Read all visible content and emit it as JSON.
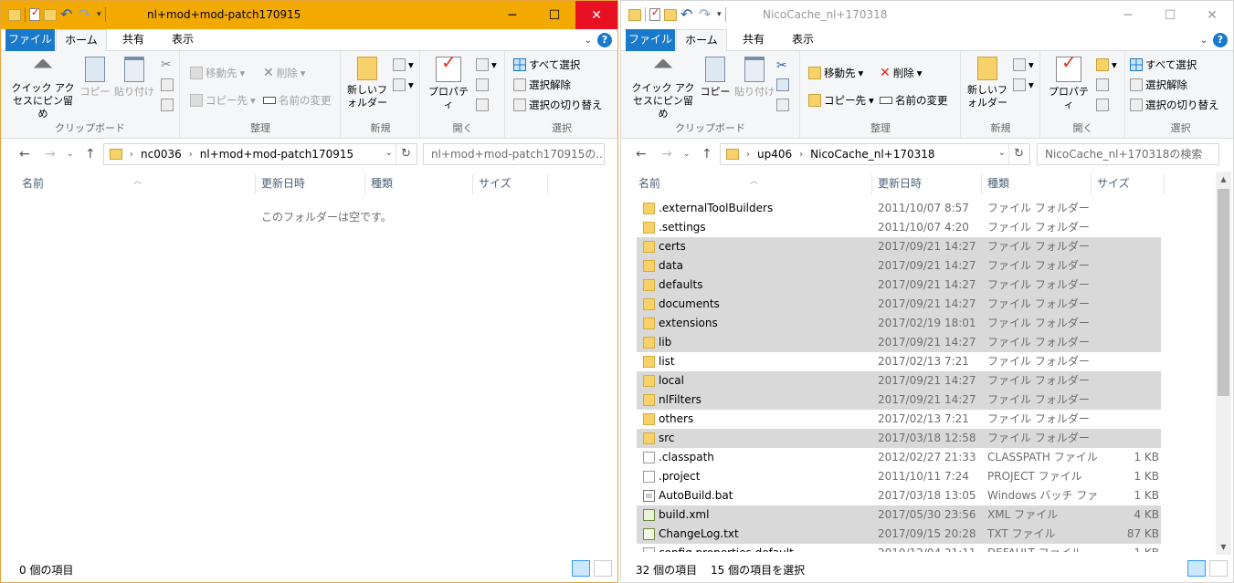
{
  "left": {
    "title": "nl+mod+mod-patch170915",
    "tabs": {
      "file": "ファイル",
      "home": "ホーム",
      "share": "共有",
      "view": "表示"
    },
    "ribbon": {
      "pin": "クイック アクセスにピン留め",
      "copy": "コピー",
      "paste": "貼り付け",
      "clipboard": "クリップボード",
      "move_to": "移動先",
      "copy_to": "コピー先",
      "delete": "削除",
      "rename": "名前の変更",
      "organize": "整理",
      "new_folder": "新しいフォルダー",
      "new": "新規",
      "properties": "プロパティ",
      "open": "開く",
      "select_all": "すべて選択",
      "select_none": "選択解除",
      "invert": "選択の切り替え",
      "select": "選択"
    },
    "address": {
      "root": "nc0036",
      "folder": "nl+mod+mod-patch170915"
    },
    "search_placeholder": "nl+mod+mod-patch170915の...",
    "columns": {
      "name": "名前",
      "date": "更新日時",
      "type": "種類",
      "size": "サイズ"
    },
    "empty_text": "このフォルダーは空です。",
    "status_count": "0 個の項目"
  },
  "right": {
    "title": "NicoCache_nl+170318",
    "tabs": {
      "file": "ファイル",
      "home": "ホーム",
      "share": "共有",
      "view": "表示"
    },
    "ribbon": {
      "pin": "クイック アクセスにピン留め",
      "copy": "コピー",
      "paste": "貼り付け",
      "clipboard": "クリップボード",
      "move_to": "移動先",
      "copy_to": "コピー先",
      "delete": "削除",
      "rename": "名前の変更",
      "organize": "整理",
      "new_folder": "新しいフォルダー",
      "new": "新規",
      "properties": "プロパティ",
      "open": "開く",
      "select_all": "すべて選択",
      "select_none": "選択解除",
      "invert": "選択の切り替え",
      "select": "選択"
    },
    "address": {
      "root": "up406",
      "folder": "NicoCache_nl+170318"
    },
    "search_placeholder": "NicoCache_nl+170318の検索",
    "columns": {
      "name": "名前",
      "date": "更新日時",
      "type": "種類",
      "size": "サイズ"
    },
    "files": [
      {
        "name": ".externalToolBuilders",
        "date": "2011/10/07 8:57",
        "type": "ファイル フォルダー",
        "size": "",
        "icon": "folder",
        "selected": false
      },
      {
        "name": ".settings",
        "date": "2011/10/07 4:20",
        "type": "ファイル フォルダー",
        "size": "",
        "icon": "folder",
        "selected": false
      },
      {
        "name": "certs",
        "date": "2017/09/21 14:27",
        "type": "ファイル フォルダー",
        "size": "",
        "icon": "folder",
        "selected": true
      },
      {
        "name": "data",
        "date": "2017/09/21 14:27",
        "type": "ファイル フォルダー",
        "size": "",
        "icon": "folder",
        "selected": true
      },
      {
        "name": "defaults",
        "date": "2017/09/21 14:27",
        "type": "ファイル フォルダー",
        "size": "",
        "icon": "folder",
        "selected": true
      },
      {
        "name": "documents",
        "date": "2017/09/21 14:27",
        "type": "ファイル フォルダー",
        "size": "",
        "icon": "folder",
        "selected": true
      },
      {
        "name": "extensions",
        "date": "2017/02/19 18:01",
        "type": "ファイル フォルダー",
        "size": "",
        "icon": "folder",
        "selected": true
      },
      {
        "name": "lib",
        "date": "2017/09/21 14:27",
        "type": "ファイル フォルダー",
        "size": "",
        "icon": "folder",
        "selected": true
      },
      {
        "name": "list",
        "date": "2017/02/13 7:21",
        "type": "ファイル フォルダー",
        "size": "",
        "icon": "folder",
        "selected": false
      },
      {
        "name": "local",
        "date": "2017/09/21 14:27",
        "type": "ファイル フォルダー",
        "size": "",
        "icon": "folder",
        "selected": true
      },
      {
        "name": "nlFilters",
        "date": "2017/09/21 14:27",
        "type": "ファイル フォルダー",
        "size": "",
        "icon": "folder",
        "selected": true
      },
      {
        "name": "others",
        "date": "2017/02/13 7:21",
        "type": "ファイル フォルダー",
        "size": "",
        "icon": "folder",
        "selected": false
      },
      {
        "name": "src",
        "date": "2017/03/18 12:58",
        "type": "ファイル フォルダー",
        "size": "",
        "icon": "folder",
        "selected": true
      },
      {
        "name": ".classpath",
        "date": "2012/02/27 21:33",
        "type": "CLASSPATH ファイル",
        "size": "1 KB",
        "icon": "file",
        "selected": false
      },
      {
        "name": ".project",
        "date": "2011/10/11 7:24",
        "type": "PROJECT ファイル",
        "size": "1 KB",
        "icon": "file",
        "selected": false
      },
      {
        "name": "AutoBuild.bat",
        "date": "2017/03/18 13:05",
        "type": "Windows バッチ ファ...",
        "size": "1 KB",
        "icon": "bat",
        "selected": false
      },
      {
        "name": "build.xml",
        "date": "2017/05/30 23:56",
        "type": "XML ファイル",
        "size": "4 KB",
        "icon": "xml",
        "selected": true
      },
      {
        "name": "ChangeLog.txt",
        "date": "2017/09/15 20:28",
        "type": "TXT ファイル",
        "size": "87 KB",
        "icon": "txt",
        "selected": true
      },
      {
        "name": "config.properties.default",
        "date": "2010/12/04 21:11",
        "type": "DEFAULT ファイル",
        "size": "1 KB",
        "icon": "file",
        "selected": false
      }
    ],
    "status_count": "32 個の項目",
    "status_selected": "15 個の項目を選択"
  }
}
